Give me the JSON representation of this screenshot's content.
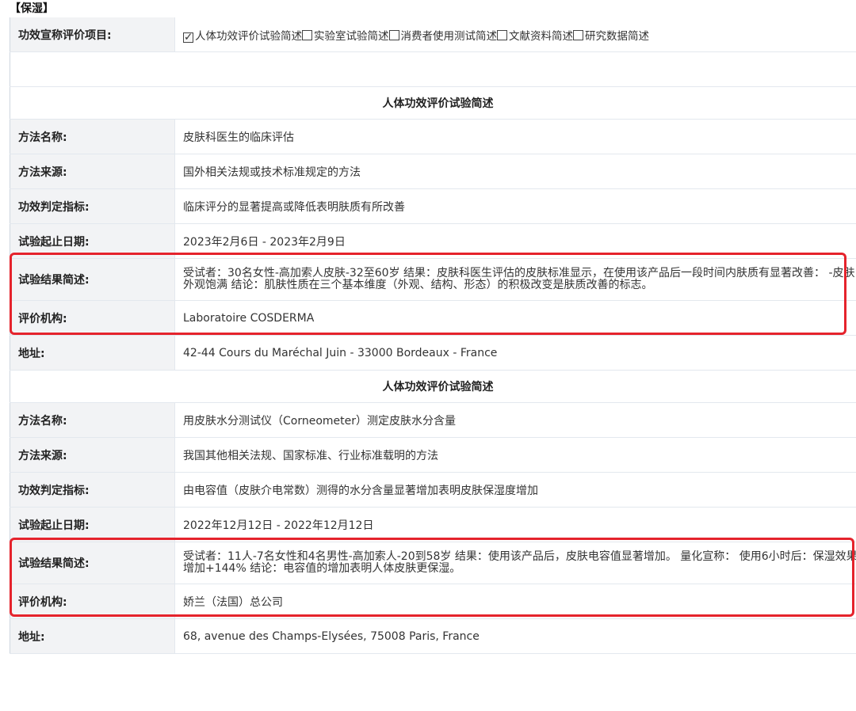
{
  "section_title": "【保湿】",
  "claim_row": {
    "label": "功效宣称评价项目:",
    "options": [
      {
        "text": "人体功效评价试验简述",
        "checked": true
      },
      {
        "text": "实验室试验简述",
        "checked": false
      },
      {
        "text": "消费者使用测试简述",
        "checked": false
      },
      {
        "text": "文献资料简述",
        "checked": false
      },
      {
        "text": "研究数据简述",
        "checked": false
      }
    ]
  },
  "checkmark": "✓",
  "blocks": [
    {
      "title": "人体功效评价试验简述",
      "rows": [
        {
          "label": "方法名称:",
          "value": "皮肤科医生的临床评估"
        },
        {
          "label": "方法来源:",
          "value": "国外相关法规或技术标准规定的方法"
        },
        {
          "label": "功效判定指标:",
          "value": "临床评分的显著提高或降低表明肤质有所改善"
        },
        {
          "label": "试验起止日期:",
          "value": "2023年2月6日 - 2023年2月9日"
        },
        {
          "label": "试验结果简述:",
          "value": "受试者：30名女性-高加索人皮肤-32至60岁 结果：皮肤科医生评估的皮肤标准显示，在使用该产品后一段时间内肤质有显著改善： -皮肤外观饱满 结论：肌肤性质在三个基本维度（外观、结构、形态）的积极改变是肤质改善的标志。"
        },
        {
          "label": "评价机构:",
          "value": "Laboratoire COSDERMA"
        },
        {
          "label": "地址:",
          "value": "42-44 Cours du Maréchal Juin - 33000 Bordeaux - France"
        }
      ]
    },
    {
      "title": "人体功效评价试验简述",
      "rows": [
        {
          "label": "方法名称:",
          "value": "用皮肤水分测试仪（Corneometer）测定皮肤水分含量"
        },
        {
          "label": "方法来源:",
          "value": "我国其他相关法规、国家标准、行业标准载明的方法"
        },
        {
          "label": "功效判定指标:",
          "value": "由电容值（皮肤介电常数）测得的水分含量显著增加表明皮肤保湿度增加"
        },
        {
          "label": "试验起止日期:",
          "value": "2022年12月12日 - 2022年12月12日"
        },
        {
          "label": "试验结果简述:",
          "value": "受试者：11人-7名女性和4名男性-高加索人-20到58岁 结果：使用该产品后，皮肤电容值显著增加。 量化宣称： 使用6小时后：保湿效果增加+144% 结论：电容值的增加表明人体皮肤更保湿。"
        },
        {
          "label": "评价机构:",
          "value": "娇兰（法国）总公司"
        },
        {
          "label": "地址:",
          "value": "68, avenue des Champs-Elysées, 75008 Paris, France"
        }
      ]
    }
  ],
  "highlight_color": "#e5232c"
}
